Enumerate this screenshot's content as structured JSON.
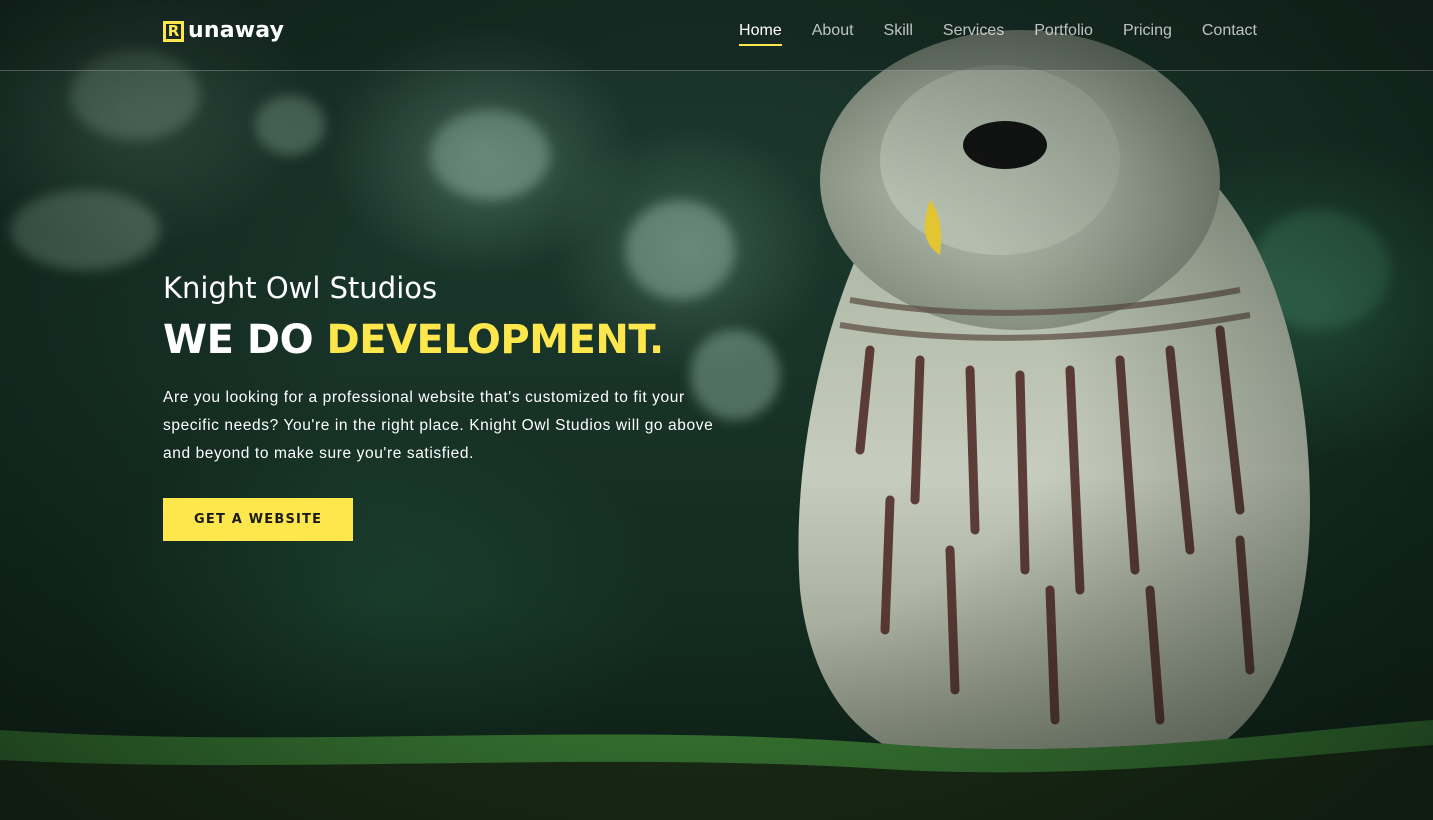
{
  "brand": {
    "logo_letter": "R",
    "name": "unaway"
  },
  "nav": {
    "items": [
      {
        "label": "Home",
        "active": true
      },
      {
        "label": "About",
        "active": false
      },
      {
        "label": "Skill",
        "active": false
      },
      {
        "label": "Services",
        "active": false
      },
      {
        "label": "Portfolio",
        "active": false
      },
      {
        "label": "Pricing",
        "active": false
      },
      {
        "label": "Contact",
        "active": false
      }
    ]
  },
  "hero": {
    "subtitle": "Knight Owl Studios",
    "title_white": "WE DO ",
    "title_yellow": "DEVELOPMENT.",
    "description": "Are you looking for a professional website that's customized to fit your specific needs? You're in the right place. Knight Owl Studios will go above and beyond to make sure you're satisfied.",
    "cta_label": "GET A WEBSITE"
  },
  "colors": {
    "accent": "#fde74c",
    "text": "#ffffff",
    "background": "#183328"
  },
  "icons": {
    "logo": "logo-r-icon"
  }
}
